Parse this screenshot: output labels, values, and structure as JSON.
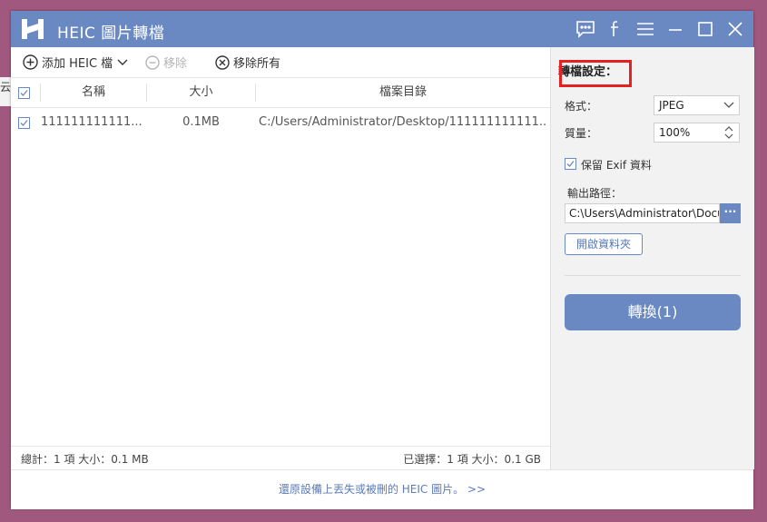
{
  "desktop": {
    "left_glyph": "云"
  },
  "app": {
    "title": "HEIC 圖片轉檔"
  },
  "titlebar_icons": [
    "feedback-icon",
    "facebook-icon",
    "menu-icon",
    "minimize-icon",
    "maximize-icon",
    "close-icon"
  ],
  "toolbar": {
    "add_label": "添加 HEIC 檔",
    "remove_label": "移除",
    "remove_all_label": "移除所有"
  },
  "table": {
    "headers": {
      "name": "名稱",
      "size": "大小",
      "dir": "檔案目錄"
    },
    "rows": [
      {
        "checked": true,
        "name": "111111111111...",
        "size": "0.1MB",
        "dir": "C:/Users/Administrator/Desktop/111111111111..."
      }
    ]
  },
  "status": {
    "total": "總計：1 項 大小：0.1 MB",
    "selected": "已選擇：1 項 大小：0.1 GB"
  },
  "settings": {
    "title": "轉檔設定：",
    "format_label": "格式：",
    "format_value": "JPEG",
    "quality_label": "質量：",
    "quality_value": "100%",
    "keep_exif_label": "保留 Exif 資料",
    "keep_exif_checked": true,
    "output_label": "輸出路徑：",
    "output_path": "C:\\Users\\Administrator\\Docu",
    "browse_label": "···",
    "open_folder_label": "開啟資料夾",
    "convert_label": "轉換(1)"
  },
  "footer": {
    "link_text": "還原設備上丟失或被刪的 HEIC 圖片。 >>"
  },
  "colors": {
    "accent": "#6a89c2",
    "desktop": "#a0587f",
    "highlight": "#e62020"
  }
}
